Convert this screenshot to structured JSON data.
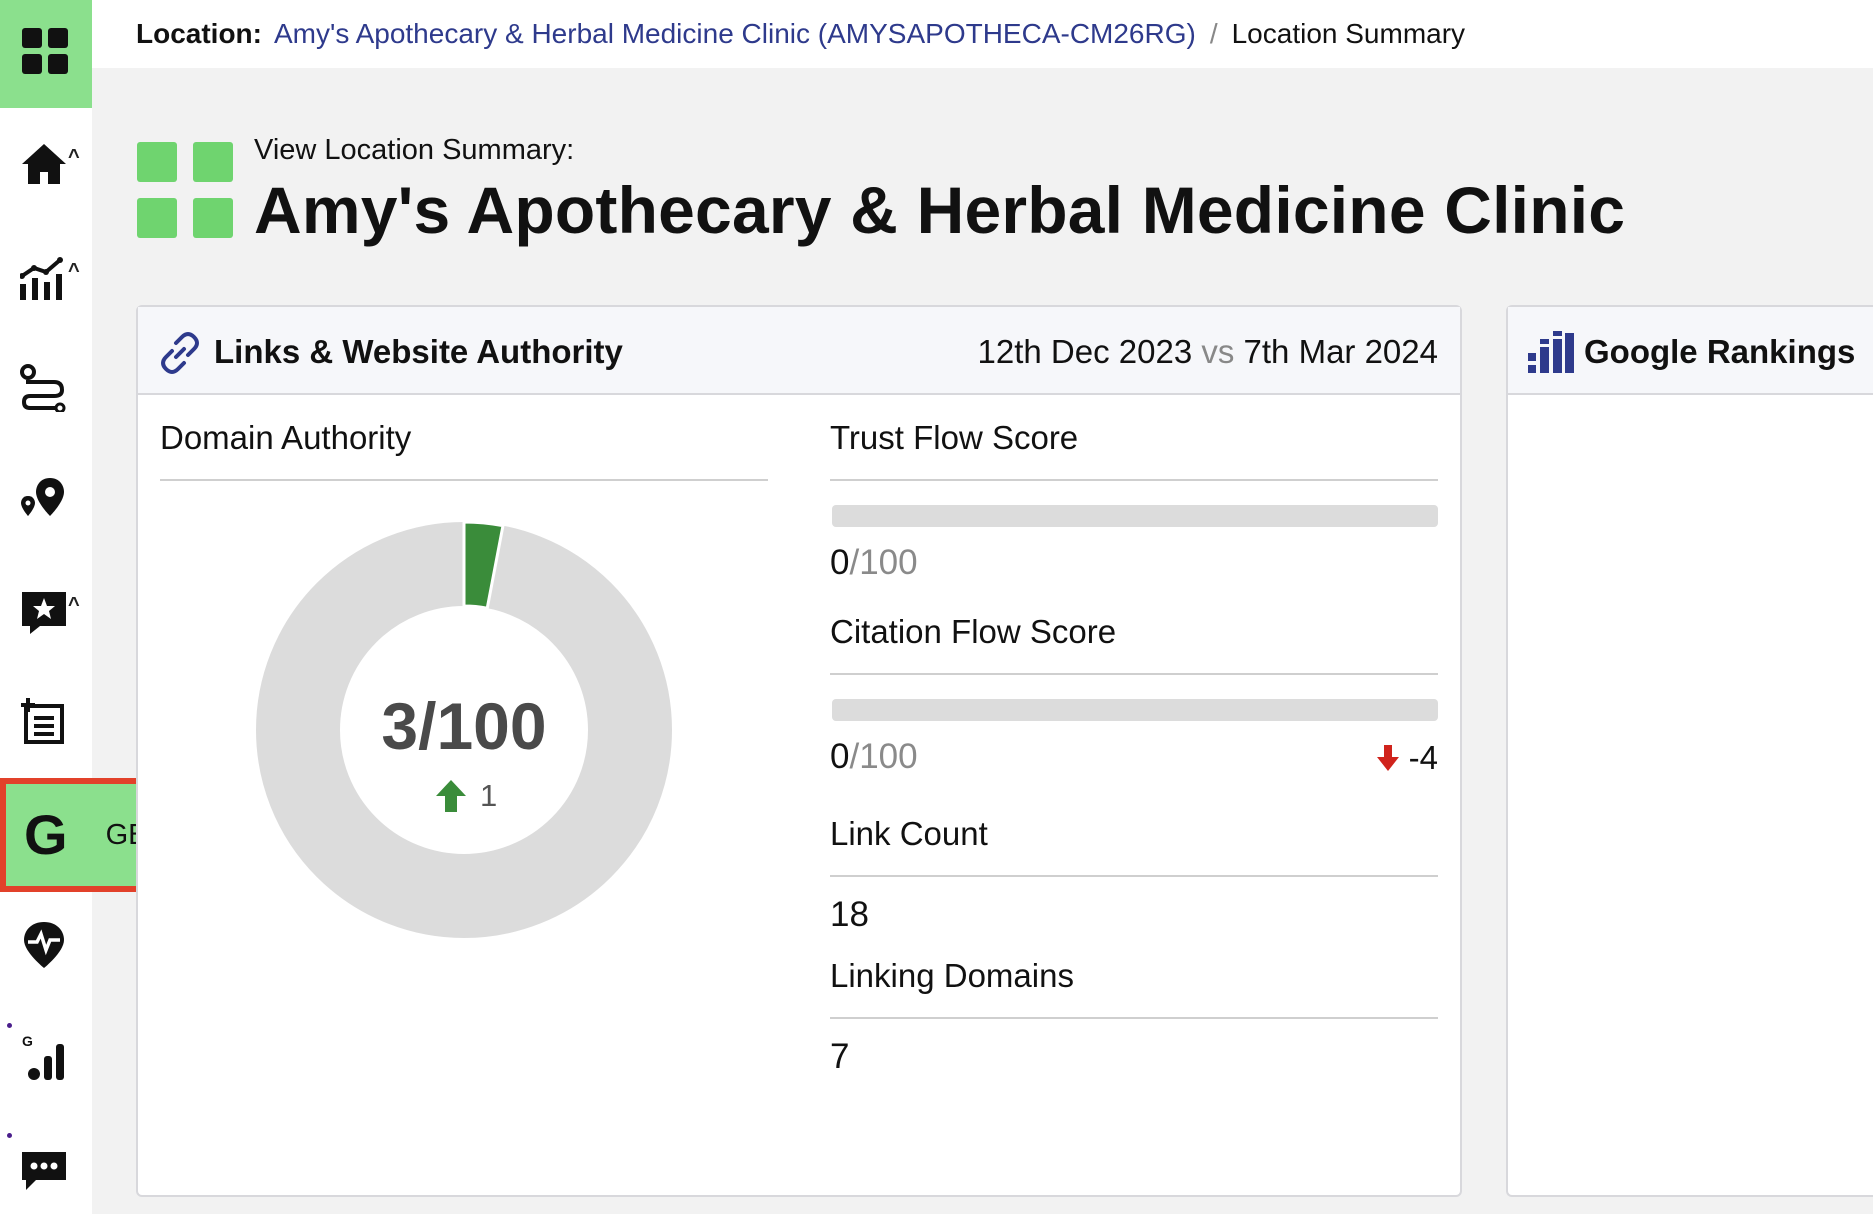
{
  "breadcrumb": {
    "label": "Location:",
    "location": "Amy's Apothecary & Herbal Medicine Clinic (AMYSAPOTHECA-CM26RG)",
    "separator": "/",
    "current": "Location Summary"
  },
  "header": {
    "subtitle": "View Location Summary:",
    "title": "Amy's Apothecary & Herbal Medicine Clinic"
  },
  "sidebar": {
    "items": [
      {
        "icon": "dashboard-grid-icon"
      },
      {
        "icon": "home-icon"
      },
      {
        "icon": "analytics-chart-icon"
      },
      {
        "icon": "route-icon"
      },
      {
        "icon": "map-pins-icon"
      },
      {
        "icon": "reviews-star-icon"
      },
      {
        "icon": "list-add-icon"
      },
      {
        "icon": "google-g-icon"
      },
      {
        "icon": "health-pin-icon"
      },
      {
        "icon": "google-rankings-icon"
      },
      {
        "icon": "chat-icon"
      }
    ],
    "flyout": {
      "label": "GBP Audit",
      "glyph": "G"
    }
  },
  "links_card": {
    "title": "Links & Website Authority",
    "date_from": "12th Dec 2023",
    "vs": "vs",
    "date_to": "7th Mar 2024",
    "domain_authority": {
      "title": "Domain Authority",
      "value": 3,
      "display": "3/100",
      "delta": "1"
    },
    "trust_flow": {
      "title": "Trust Flow Score",
      "value": 0,
      "num": "0",
      "den": "/100"
    },
    "citation_flow": {
      "title": "Citation Flow Score",
      "value": 0,
      "num": "0",
      "den": "/100",
      "delta": "-4"
    },
    "link_count": {
      "title": "Link Count",
      "value": "18"
    },
    "linking_domains": {
      "title": "Linking Domains",
      "value": "7"
    }
  },
  "rankings_card": {
    "title": "Google Rankings"
  },
  "colors": {
    "accent_green": "#8be08d",
    "logo_green": "#6fd46f",
    "donut_fill": "#3a8c3a",
    "donut_track": "#dcdcdc",
    "link_blue": "#2e3a8c",
    "highlight_border": "#e2412a",
    "up_arrow": "#3a8c3a",
    "down_arrow": "#d0231c"
  }
}
